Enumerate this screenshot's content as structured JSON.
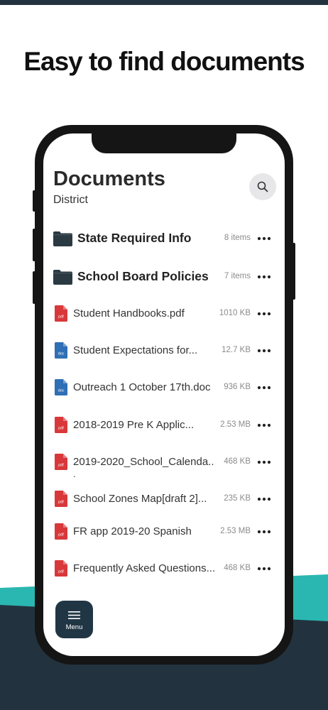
{
  "headline": "Easy to find documents",
  "header": {
    "title": "Documents",
    "subtitle": "District"
  },
  "items": [
    {
      "kind": "folder",
      "name": "State Required Info",
      "meta": "8 items"
    },
    {
      "kind": "folder",
      "name": "School Board Policies",
      "meta": "7 items"
    },
    {
      "kind": "pdf",
      "badge": "pdf",
      "name": "Student Handbooks.pdf",
      "meta": "1010 KB"
    },
    {
      "kind": "doc",
      "badge": "doc",
      "name": "Student Expectations for...",
      "meta": "12.7 KB"
    },
    {
      "kind": "doc",
      "badge": "doc",
      "name": "Outreach 1 October 17th.doc",
      "meta": "936 KB"
    },
    {
      "kind": "pdf",
      "badge": "pdf",
      "name": "2018-2019 Pre K Applic...",
      "meta": "2.53 MB"
    },
    {
      "kind": "pdf",
      "badge": "pdf",
      "name": "2019-2020_School_Calenda..",
      "meta": "468 KB",
      "wrap": "."
    },
    {
      "kind": "pdf",
      "badge": "pdf",
      "name": "School Zones Map[draft 2]...",
      "meta": "235 KB"
    },
    {
      "kind": "pdf",
      "badge": "pdf",
      "name": "FR app 2019-20 Spanish",
      "meta": "2.53 MB"
    },
    {
      "kind": "pdf",
      "badge": "pdf",
      "name": "Frequently Asked Questions...",
      "meta": "468 KB"
    }
  ],
  "menu": {
    "label": "Menu"
  },
  "icons": {
    "search": "search-icon",
    "folder": "folder-icon",
    "pdf": "pdf-file-icon",
    "doc": "doc-file-icon",
    "more": "more-options-icon",
    "menu": "hamburger-menu-icon"
  },
  "colors": {
    "navy": "#213645",
    "teal": "#2ab7b1",
    "pdf_red": "#d8383a",
    "doc_blue": "#2f6fb5",
    "folder": "#2b3942"
  }
}
